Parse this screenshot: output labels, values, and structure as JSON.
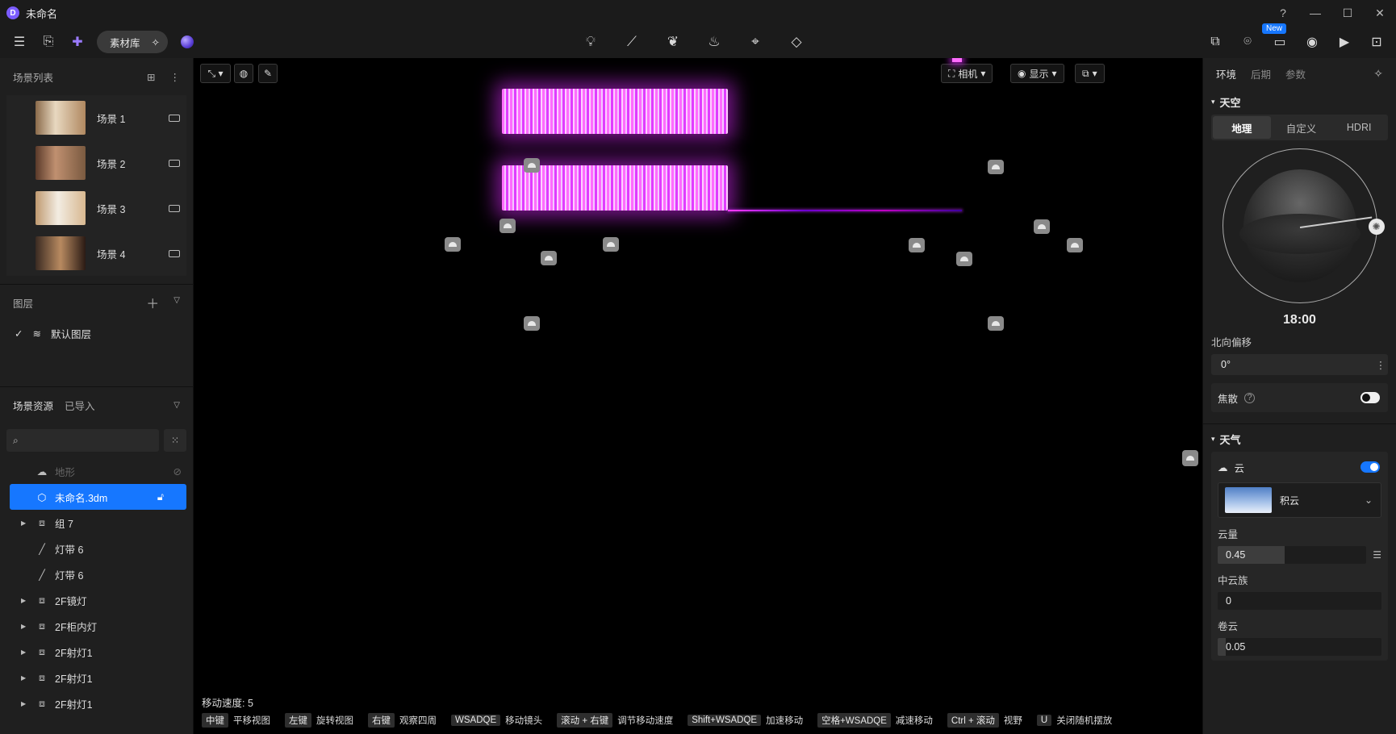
{
  "window": {
    "title": "未命名",
    "help": "?",
    "minimize": "—",
    "maximize": "☐",
    "close": "✕"
  },
  "toolbar": {
    "asset_library": "素材库",
    "new_badge": "New",
    "center_tools": [
      "light-bulb-icon",
      "spline-icon",
      "leaf-icon",
      "flame-icon",
      "cursor-plus-icon",
      "surface-icon"
    ],
    "right_tools": [
      "image-edit-icon",
      "pin-icon",
      "render-queue-icon",
      "camera-icon",
      "video-icon",
      "inbox-icon"
    ]
  },
  "scene_list": {
    "title": "场景列表",
    "items": [
      {
        "name": "场景 1"
      },
      {
        "name": "场景 2"
      },
      {
        "name": "场景 3"
      },
      {
        "name": "场景 4"
      }
    ]
  },
  "layers": {
    "title": "图层",
    "items": [
      {
        "name": "默认图层",
        "checked": true
      }
    ]
  },
  "assets": {
    "tab_scene": "场景资源",
    "tab_imported": "已导入",
    "search_placeholder": "",
    "tree": [
      {
        "name": "地形",
        "type": "terrain",
        "dim": true,
        "caret": false
      },
      {
        "name": "未命名.3dm",
        "type": "model",
        "selected": true,
        "caret": false
      },
      {
        "name": "组 7",
        "type": "group",
        "caret": true
      },
      {
        "name": "灯带 6",
        "type": "line",
        "caret": false
      },
      {
        "name": "灯带 6",
        "type": "line",
        "caret": false
      },
      {
        "name": "2F镜灯",
        "type": "group",
        "caret": true
      },
      {
        "name": "2F柜内灯",
        "type": "group",
        "caret": true
      },
      {
        "name": "2F射灯1",
        "type": "group",
        "caret": true
      },
      {
        "name": "2F射灯1",
        "type": "group",
        "caret": true
      },
      {
        "name": "2F射灯1",
        "type": "group",
        "caret": true
      }
    ]
  },
  "viewport": {
    "camera_label": "相机",
    "display_label": "显示",
    "move_speed": "移动速度: 5",
    "hints": [
      {
        "key": "中键",
        "text": "平移视图"
      },
      {
        "key": "左键",
        "text": "旋转视图"
      },
      {
        "key": "右键",
        "text": "观察四周"
      },
      {
        "key": "WSADQE",
        "text": "移动镜头"
      },
      {
        "key": "滚动 + 右键",
        "text": "调节移动速度"
      },
      {
        "key": "Shift+WSADQE",
        "text": "加速移动"
      },
      {
        "key": "空格+WSADQE",
        "text": "减速移动"
      },
      {
        "key": "Ctrl + 滚动",
        "text": "视野"
      },
      {
        "key": "U",
        "text": "关闭随机摆放"
      }
    ]
  },
  "right_panel": {
    "tabs": [
      "环境",
      "后期",
      "参数"
    ],
    "sky": {
      "title": "天空",
      "modes": [
        "地理",
        "自定义",
        "HDRI"
      ],
      "time": "18:00",
      "north_offset_label": "北向偏移",
      "north_offset_value": "0°",
      "caustics_label": "焦散",
      "caustics_enabled": false
    },
    "weather": {
      "title": "天气",
      "cloud_label": "云",
      "cloud_enabled": true,
      "cloud_type": "积云",
      "cloud_amount_label": "云量",
      "cloud_amount": "0.45",
      "cloud_amount_fraction": 0.45,
      "mid_cloud_label": "中云族",
      "mid_cloud": "0",
      "mid_cloud_fraction": 0,
      "cirrus_label": "卷云",
      "cirrus": "0.05",
      "cirrus_fraction": 0.05
    }
  },
  "colors": {
    "accent": "#1677ff",
    "glow": "#e03cff",
    "panel": "#1f1f1f"
  }
}
